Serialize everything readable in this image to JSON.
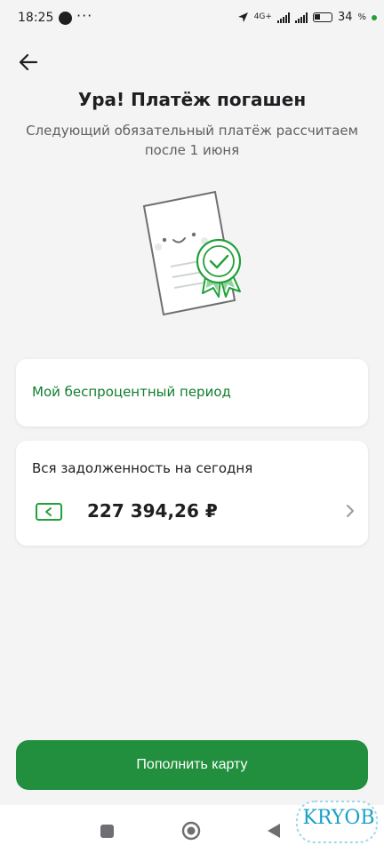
{
  "status_bar": {
    "time": "18:25",
    "dots": "···",
    "network": "4G+",
    "battery": "34"
  },
  "header": {
    "title": "Ура! Платёж погашен",
    "subtitle": "Следующий обязательный платёж рассчитаем после 1 июня"
  },
  "interest_free": {
    "label": "Мой беспроцентный период"
  },
  "debt": {
    "label": "Вся задолженность на сегодня",
    "amount": "227 394,26 ₽"
  },
  "actions": {
    "topup_label": "Пополнить карту"
  },
  "watermark": {
    "text": "KRYOB"
  },
  "colors": {
    "brand_green": "#218f3e",
    "link_green": "#107f2c",
    "background": "#f4f4f4"
  },
  "icons": {
    "back": "arrow-left-icon",
    "document": "document-check-illustration",
    "card": "card-icon",
    "chevron": "chevron-right-icon"
  }
}
